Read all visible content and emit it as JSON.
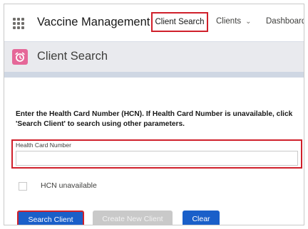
{
  "app": {
    "name": "Vaccine Management"
  },
  "nav": {
    "tabs": [
      {
        "label": "Client Search",
        "active": true
      },
      {
        "label": "Clients",
        "has_dropdown": true
      },
      {
        "label": "Dashboards"
      }
    ]
  },
  "header": {
    "title": "Client Search",
    "icon": "alarm-clock-icon"
  },
  "form": {
    "instructions": "Enter the Health Card Number (HCN). If Health Card Number is unavailable, click 'Search Client' to search using other parameters.",
    "hcn_label": "Health Card Number",
    "hcn_value": "",
    "hcn_checkbox_label": "HCN unavailable"
  },
  "buttons": {
    "search": "Search Client",
    "create": "Create New Client",
    "clear": "Clear"
  },
  "colors": {
    "highlight": "#d0202b",
    "brand": "#1a5fc9",
    "icon_bg": "#e56798"
  }
}
